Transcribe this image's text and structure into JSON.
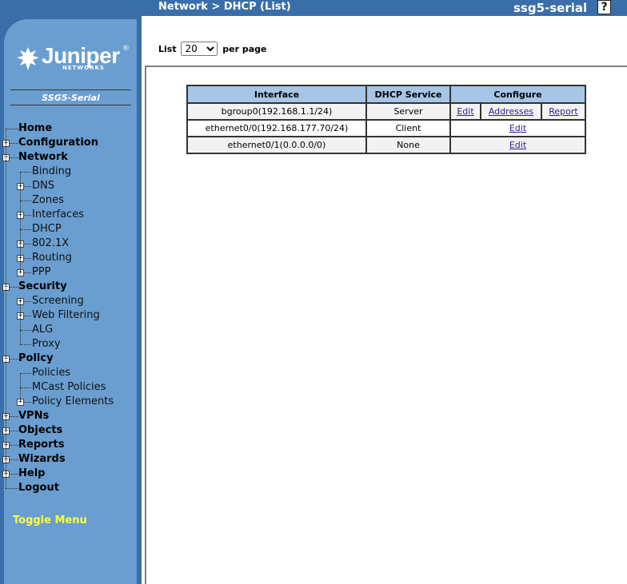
{
  "header": {
    "title": "Network > DHCP (List)",
    "hostname": "ssg5-serial",
    "help_label": "?"
  },
  "brand": {
    "logo_text": "Juniper",
    "logo_sub": "NETWORKS",
    "logo_reg": "®",
    "model": "SSG5-Serial"
  },
  "menu": [
    {
      "label": "Home",
      "level": 0,
      "expander": "none"
    },
    {
      "label": "Configuration",
      "level": 0,
      "expander": "plus"
    },
    {
      "label": "Network",
      "level": 0,
      "expander": "minus"
    },
    {
      "label": "Binding",
      "level": 1,
      "expander": "none"
    },
    {
      "label": "DNS",
      "level": 1,
      "expander": "plus"
    },
    {
      "label": "Zones",
      "level": 1,
      "expander": "none"
    },
    {
      "label": "Interfaces",
      "level": 1,
      "expander": "plus"
    },
    {
      "label": "DHCP",
      "level": 1,
      "expander": "none"
    },
    {
      "label": "802.1X",
      "level": 1,
      "expander": "plus"
    },
    {
      "label": "Routing",
      "level": 1,
      "expander": "plus"
    },
    {
      "label": "PPP",
      "level": 1,
      "expander": "plus"
    },
    {
      "label": "Security",
      "level": 0,
      "expander": "minus"
    },
    {
      "label": "Screening",
      "level": 1,
      "expander": "plus"
    },
    {
      "label": "Web Filtering",
      "level": 1,
      "expander": "plus"
    },
    {
      "label": "ALG",
      "level": 1,
      "expander": "none"
    },
    {
      "label": "Proxy",
      "level": 1,
      "expander": "none"
    },
    {
      "label": "Policy",
      "level": 0,
      "expander": "minus"
    },
    {
      "label": "Policies",
      "level": 1,
      "expander": "none"
    },
    {
      "label": "MCast Policies",
      "level": 1,
      "expander": "none"
    },
    {
      "label": "Policy Elements",
      "level": 1,
      "expander": "plus"
    },
    {
      "label": "VPNs",
      "level": 0,
      "expander": "plus"
    },
    {
      "label": "Objects",
      "level": 0,
      "expander": "plus"
    },
    {
      "label": "Reports",
      "level": 0,
      "expander": "plus"
    },
    {
      "label": "Wizards",
      "level": 0,
      "expander": "plus"
    },
    {
      "label": "Help",
      "level": 0,
      "expander": "plus"
    },
    {
      "label": "Logout",
      "level": 0,
      "expander": "none"
    }
  ],
  "toggle_menu": "Toggle Menu",
  "list": {
    "prefix": "List",
    "value": "20",
    "suffix": "per page",
    "options": [
      "20"
    ]
  },
  "table": {
    "headers": [
      "Interface",
      "DHCP Service",
      "Configure"
    ],
    "rows": [
      {
        "interface": "bgroup0(192.168.1.1/24)",
        "service": "Server",
        "links": [
          "Edit",
          "Addresses",
          "Report"
        ]
      },
      {
        "interface": "ethernet0/0(192.168.177.70/24)",
        "service": "Client",
        "links": [
          "Edit"
        ]
      },
      {
        "interface": "ethernet0/1(0.0.0.0/0)",
        "service": "None",
        "links": [
          "Edit"
        ]
      }
    ]
  },
  "colors": {
    "header_bar": "#3a6ea8",
    "sidebar": "#6a9ed0",
    "table_header": "#a7c5e6",
    "toggle": "#ffff33",
    "link": "#2e2390"
  }
}
